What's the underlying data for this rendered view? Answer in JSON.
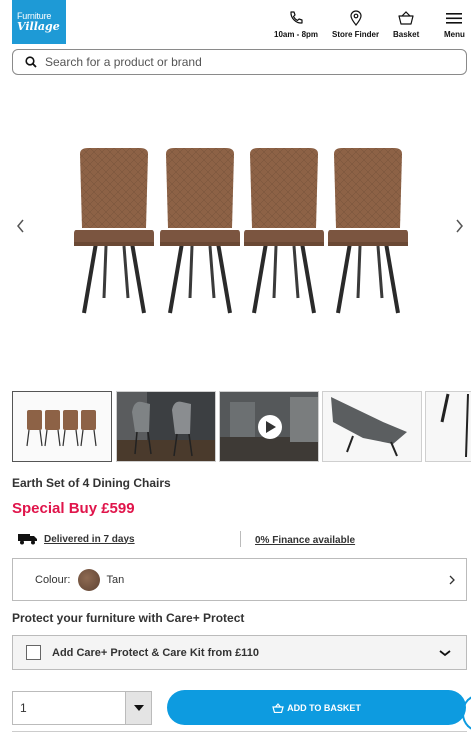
{
  "header": {
    "logo_line1": "Furniture",
    "logo_line2": "Village",
    "nav": [
      {
        "label": "10am - 8pm",
        "icon": "phone-icon"
      },
      {
        "label": "Store Finder",
        "icon": "location-pin-icon"
      },
      {
        "label": "Basket",
        "icon": "basket-icon"
      },
      {
        "label": "Menu",
        "icon": "hamburger-icon"
      }
    ]
  },
  "search": {
    "placeholder": "Search for a product or brand",
    "icon": "search-icon"
  },
  "gallery": {
    "prev_icon": "chevron-left-icon",
    "next_icon": "chevron-right-icon",
    "thumbnails": [
      {
        "name": "thumb-chairs-front",
        "active": true
      },
      {
        "name": "thumb-room-scene",
        "active": false
      },
      {
        "name": "thumb-video",
        "active": false
      },
      {
        "name": "thumb-chair-detail",
        "active": false
      },
      {
        "name": "thumb-chair-leg",
        "active": false
      }
    ]
  },
  "product": {
    "title": "Earth Set of 4 Dining Chairs",
    "price": "Special Buy £599",
    "delivery": "Delivered in 7 days",
    "finance": "0% Finance available",
    "colour_label": "Colour:",
    "colour_value": "Tan",
    "colour_hex": "#7a5641",
    "protect_title": "Protect your furniture with Care+ Protect",
    "care_option": "Add Care+ Protect & Care Kit from £110"
  },
  "purchase": {
    "quantity": "1",
    "add_to_basket": "ADD TO BASKET"
  },
  "colors": {
    "brand_blue": "#1e9ad6",
    "button_blue": "#0d9be0",
    "price_red": "#e0154b"
  }
}
